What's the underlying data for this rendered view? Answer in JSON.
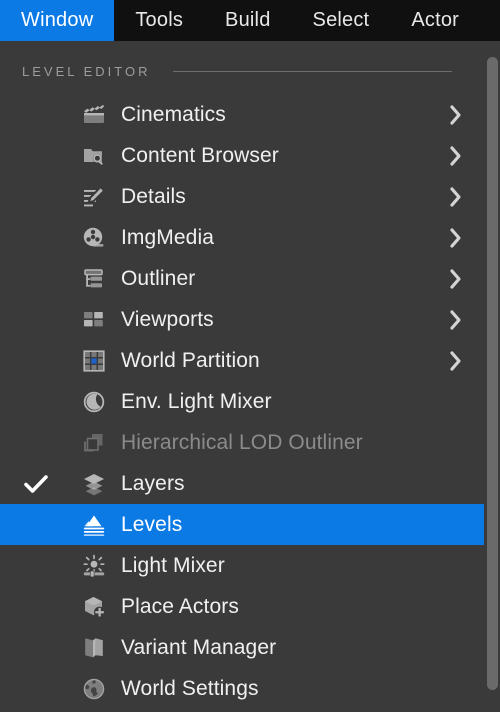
{
  "menubar": {
    "items": [
      {
        "label": "Window",
        "active": true
      },
      {
        "label": "Tools",
        "active": false
      },
      {
        "label": "Build",
        "active": false
      },
      {
        "label": "Select",
        "active": false
      },
      {
        "label": "Actor",
        "active": false
      }
    ]
  },
  "dropdown": {
    "section_label": "LEVEL EDITOR",
    "items": [
      {
        "label": "Cinematics",
        "icon": "clapperboard-icon",
        "submenu": true,
        "checked": false,
        "disabled": false,
        "selected": false
      },
      {
        "label": "Content Browser",
        "icon": "folder-search-icon",
        "submenu": true,
        "checked": false,
        "disabled": false,
        "selected": false
      },
      {
        "label": "Details",
        "icon": "pencil-lines-icon",
        "submenu": true,
        "checked": false,
        "disabled": false,
        "selected": false
      },
      {
        "label": "ImgMedia",
        "icon": "film-reel-icon",
        "submenu": true,
        "checked": false,
        "disabled": false,
        "selected": false
      },
      {
        "label": "Outliner",
        "icon": "tree-list-icon",
        "submenu": true,
        "checked": false,
        "disabled": false,
        "selected": false
      },
      {
        "label": "Viewports",
        "icon": "grid-panels-icon",
        "submenu": true,
        "checked": false,
        "disabled": false,
        "selected": false
      },
      {
        "label": "World Partition",
        "icon": "grid-cell-icon",
        "submenu": true,
        "checked": false,
        "disabled": false,
        "selected": false
      },
      {
        "label": "Env. Light Mixer",
        "icon": "moon-circle-icon",
        "submenu": false,
        "checked": false,
        "disabled": false,
        "selected": false
      },
      {
        "label": "Hierarchical LOD Outliner",
        "icon": "stacked-boxes-icon",
        "submenu": false,
        "checked": false,
        "disabled": true,
        "selected": false
      },
      {
        "label": "Layers",
        "icon": "layers-icon",
        "submenu": false,
        "checked": true,
        "disabled": false,
        "selected": false
      },
      {
        "label": "Levels",
        "icon": "mountains-icon",
        "submenu": false,
        "checked": false,
        "disabled": false,
        "selected": true
      },
      {
        "label": "Light Mixer",
        "icon": "bulb-slider-icon",
        "submenu": false,
        "checked": false,
        "disabled": false,
        "selected": false
      },
      {
        "label": "Place Actors",
        "icon": "cube-plus-icon",
        "submenu": false,
        "checked": false,
        "disabled": false,
        "selected": false
      },
      {
        "label": "Variant Manager",
        "icon": "open-book-icon",
        "submenu": false,
        "checked": false,
        "disabled": false,
        "selected": false
      },
      {
        "label": "World Settings",
        "icon": "globe-icon",
        "submenu": false,
        "checked": false,
        "disabled": false,
        "selected": false
      }
    ]
  },
  "scrollbar": {
    "name": "vertical-scrollbar"
  },
  "colors": {
    "accent_blue": "#0c7ae5",
    "menubar_bg": "#101010",
    "panel_bg": "#3a3a3a",
    "text": "#f0f0f0",
    "text_disabled": "#8b8b8b",
    "section_text": "#9d9d9d",
    "scrollbar_thumb": "#6a6a6a"
  }
}
